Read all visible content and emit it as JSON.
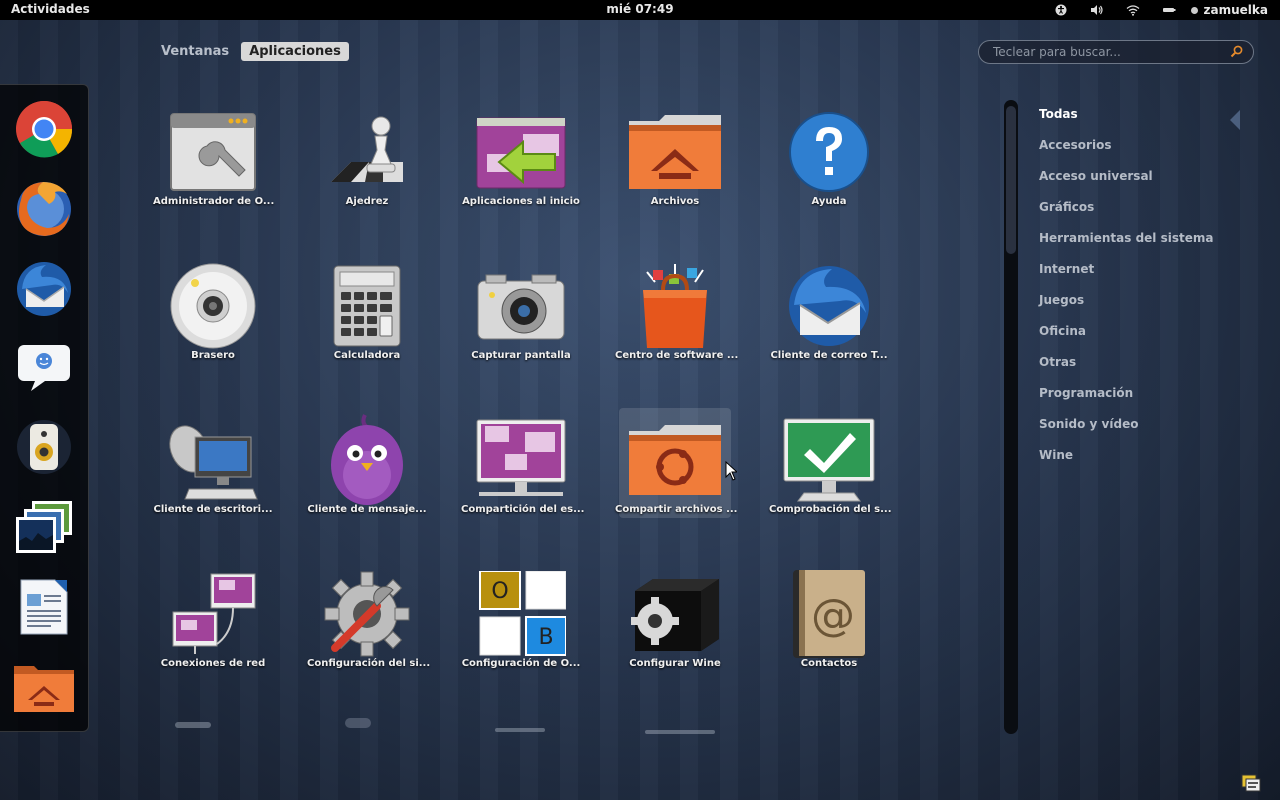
{
  "panel": {
    "activities": "Actividades",
    "clock": "mié 07:49",
    "user": "zamuelka"
  },
  "view_selector": {
    "tabs": [
      {
        "label": "Ventanas",
        "active": false
      },
      {
        "label": "Aplicaciones",
        "active": true
      }
    ]
  },
  "search": {
    "placeholder": "Teclear para buscar..."
  },
  "dash": {
    "items": [
      "chrome-icon",
      "firefox-icon",
      "thunderbird-icon",
      "empathy-icon",
      "rhythmbox-icon",
      "shotwell-icon",
      "libreoffice-writer-icon",
      "home-folder-icon"
    ]
  },
  "apps": [
    {
      "label": "Administrador de O...",
      "icon": "window-wrench-icon"
    },
    {
      "label": "Ajedrez",
      "icon": "chess-icon"
    },
    {
      "label": "Aplicaciones al inicio",
      "icon": "startup-apps-icon"
    },
    {
      "label": "Archivos",
      "icon": "home-folder-icon"
    },
    {
      "label": "Ayuda",
      "icon": "help-icon"
    },
    {
      "label": "Brasero",
      "icon": "brasero-disc-icon"
    },
    {
      "label": "Calculadora",
      "icon": "calculator-icon"
    },
    {
      "label": "Capturar pantalla",
      "icon": "camera-icon"
    },
    {
      "label": "Centro de software ...",
      "icon": "software-center-icon"
    },
    {
      "label": "Cliente de correo T...",
      "icon": "thunderbird-icon"
    },
    {
      "label": "Cliente de escritori...",
      "icon": "remote-desktop-icon"
    },
    {
      "label": "Cliente de mensaje...",
      "icon": "pidgin-icon"
    },
    {
      "label": "Compartición del es...",
      "icon": "desktop-sharing-icon"
    },
    {
      "label": "Compartir archivos ...",
      "icon": "ubuntu-folder-icon"
    },
    {
      "label": "Comprobación del s...",
      "icon": "system-check-icon"
    },
    {
      "label": "Conexiones de red",
      "icon": "network-connections-icon"
    },
    {
      "label": "Configuración del si...",
      "icon": "settings-gear-icon"
    },
    {
      "label": "Configuración de O...",
      "icon": "obconf-icon"
    },
    {
      "label": "Configurar Wine",
      "icon": "wine-config-icon"
    },
    {
      "label": "Contactos",
      "icon": "contacts-icon"
    }
  ],
  "obconf_letters": {
    "o": "O",
    "b": "B"
  },
  "categories": [
    {
      "label": "Todas",
      "active": true
    },
    {
      "label": "Accesorios"
    },
    {
      "label": "Acceso universal"
    },
    {
      "label": "Gráficos"
    },
    {
      "label": "Herramientas del sistema"
    },
    {
      "label": "Internet"
    },
    {
      "label": "Juegos"
    },
    {
      "label": "Oficina"
    },
    {
      "label": "Otras"
    },
    {
      "label": "Programación"
    },
    {
      "label": "Sonido y vídeo"
    },
    {
      "label": "Wine"
    }
  ],
  "colors": {
    "folder_orange": "#f07c3a",
    "accent_purple": "#9b3a8c",
    "ok_green": "#2e9a54",
    "help_blue": "#2f7fd0"
  }
}
